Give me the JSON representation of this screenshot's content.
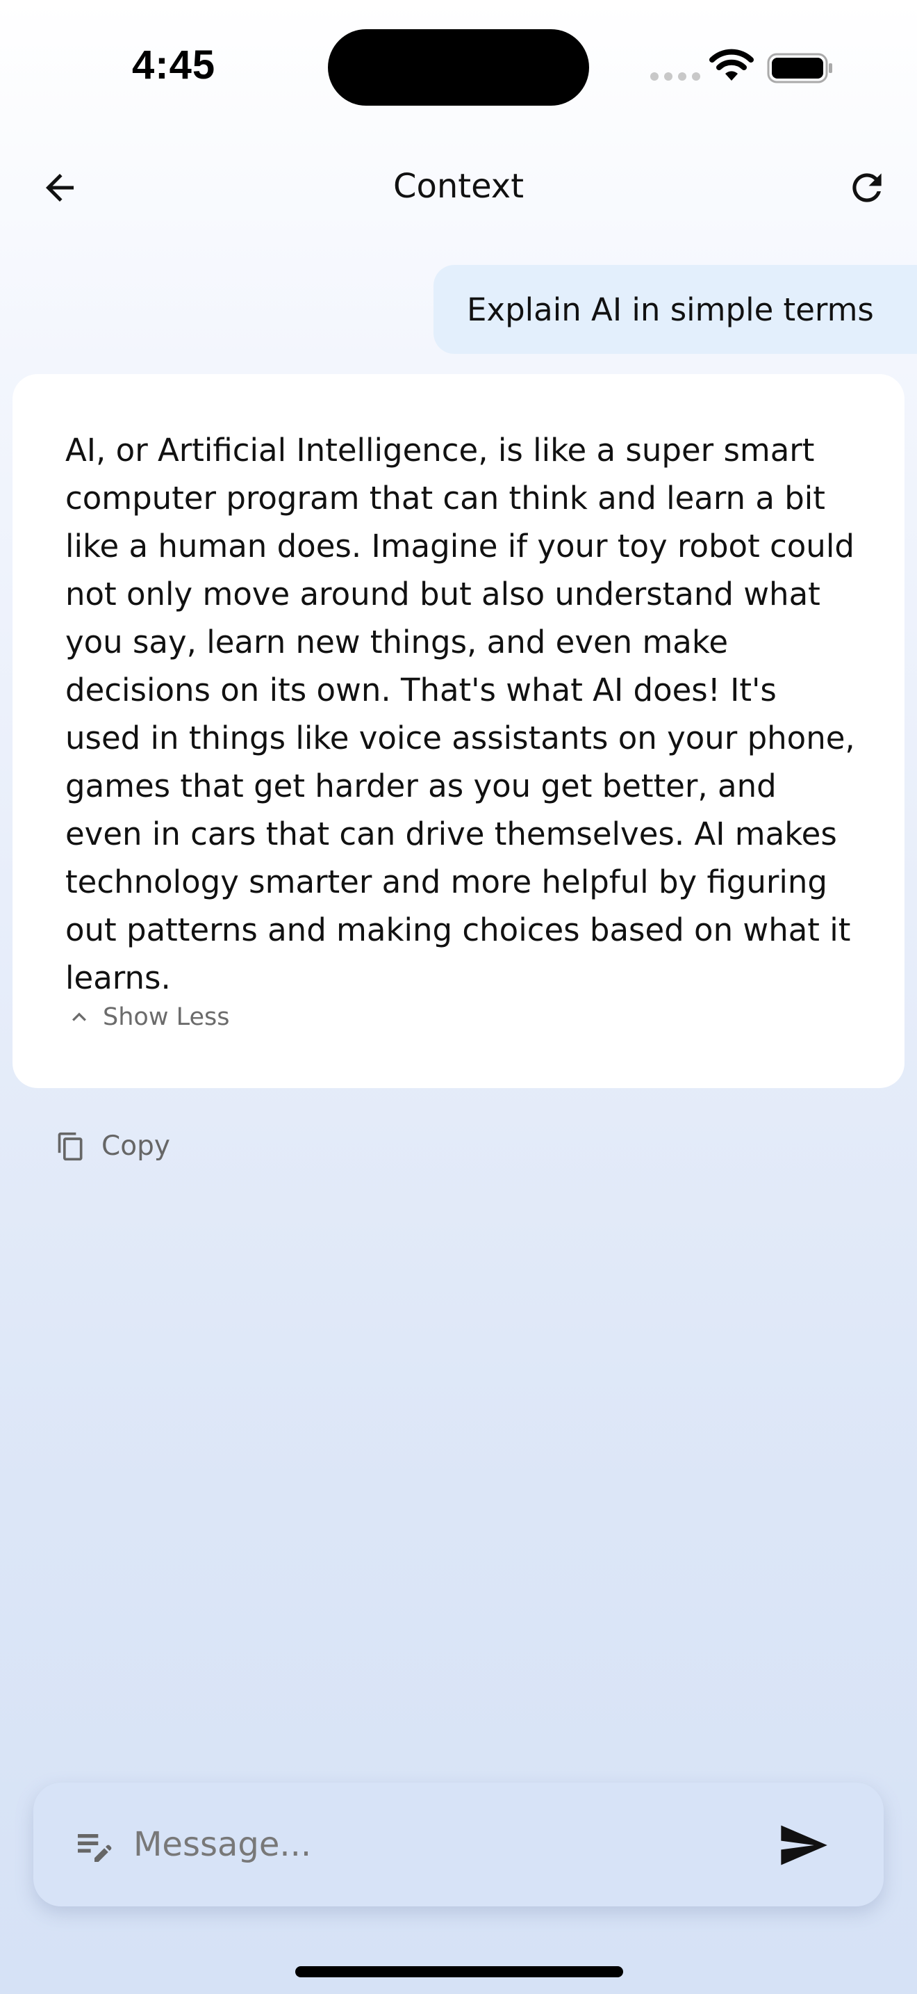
{
  "status_bar": {
    "time": "4:45"
  },
  "header": {
    "title": "Context",
    "back_icon": "arrow-left-icon",
    "refresh_icon": "refresh-icon"
  },
  "conversation": {
    "user_message": "Explain AI in simple terms",
    "assistant_message": "AI, or Artificial Intelligence, is like a super smart computer program that can think and learn a bit like a human does. Imagine if your toy robot could not only move around but also understand what you say, learn new things, and even make decisions on its own. That's what AI does! It's used in things like voice assistants on your phone, games that get harder as you get better, and even in cars that can drive themselves. AI makes technology smarter and more helpful by figuring out patterns and making choices based on what it learns.",
    "show_less_label": "Show Less",
    "copy_label": "Copy"
  },
  "composer": {
    "placeholder": "Message...",
    "value": "",
    "prompt_icon": "edit-note-icon",
    "send_icon": "send-icon"
  },
  "colors": {
    "user_bubble": "#e3effc",
    "card": "#ffffff",
    "composer": "#d7e3f7",
    "muted_text": "#6b6b6b"
  }
}
